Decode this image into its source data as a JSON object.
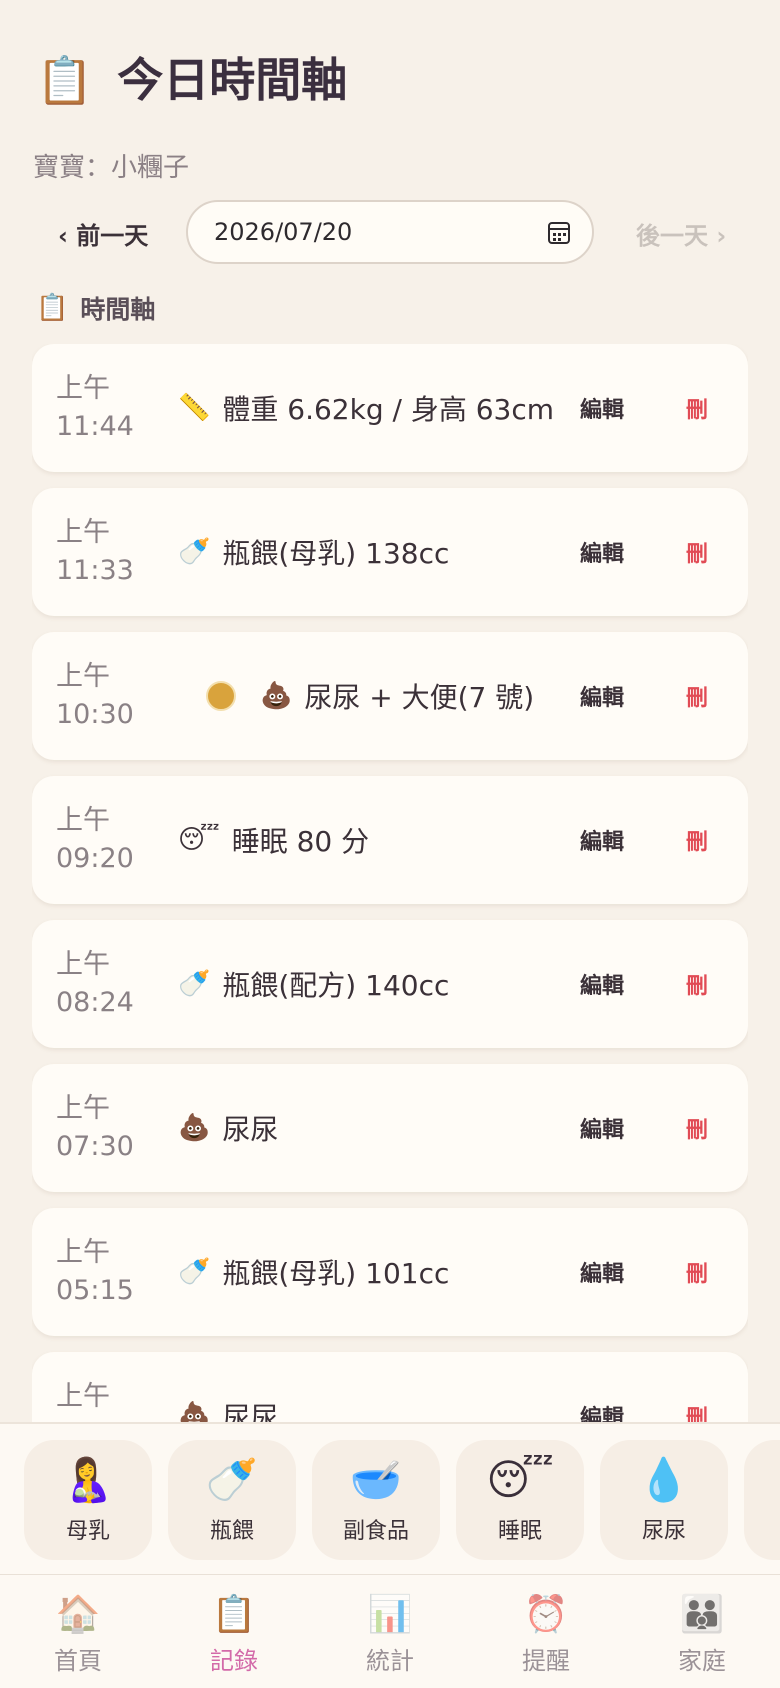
{
  "header": {
    "icon": "clipboard-icon",
    "icon_glyph": "📋",
    "title": "今日時間軸"
  },
  "baby_label": "寶寶：小糰子",
  "date_nav": {
    "prev_label": "‹ 前一天",
    "date_value": "2026/07/20",
    "next_label": "後一天 ›"
  },
  "section": {
    "icon_glyph": "📋",
    "title": "時間軸"
  },
  "entries": [
    {
      "period": "上午",
      "time": "11:44",
      "icon": "ruler-icon",
      "glyph": "📏",
      "text": "體重 6.62kg / 身高 63cm",
      "edit": "編輯",
      "delete": "刪"
    },
    {
      "period": "上午",
      "time": "11:33",
      "icon": "baby-bottle-icon",
      "glyph": "🍼",
      "text": "瓶餵(母乳) 138cc",
      "edit": "編輯",
      "delete": "刪"
    },
    {
      "period": "上午",
      "time": "10:30",
      "icon": "poop-icon",
      "glyph": "💩",
      "text": "尿尿 + 大便(7 號)",
      "stool_color": "#d9a33c",
      "edit": "編輯",
      "delete": "刪"
    },
    {
      "period": "上午",
      "time": "09:20",
      "icon": "sleeping-face-icon",
      "glyph": "😴",
      "text": "睡眠 80 分",
      "edit": "編輯",
      "delete": "刪"
    },
    {
      "period": "上午",
      "time": "08:24",
      "icon": "baby-bottle-icon",
      "glyph": "🍼",
      "text": "瓶餵(配方) 140cc",
      "edit": "編輯",
      "delete": "刪"
    },
    {
      "period": "上午",
      "time": "07:30",
      "icon": "poop-icon",
      "glyph": "💩",
      "text": "尿尿",
      "edit": "編輯",
      "delete": "刪"
    },
    {
      "period": "上午",
      "time": "05:15",
      "icon": "baby-bottle-icon",
      "glyph": "🍼",
      "text": "瓶餵(母乳) 101cc",
      "edit": "編輯",
      "delete": "刪"
    },
    {
      "period": "上午",
      "time": "",
      "icon": "poop-icon",
      "glyph": "💩",
      "text": "尿尿",
      "edit": "編輯",
      "delete": "刪"
    }
  ],
  "quick_actions": [
    {
      "icon": "breastfeeding-icon",
      "glyph": "🤱",
      "label": "母乳"
    },
    {
      "icon": "baby-bottle-icon",
      "glyph": "🍼",
      "label": "瓶餵"
    },
    {
      "icon": "bowl-icon",
      "glyph": "🥣",
      "label": "副食品"
    },
    {
      "icon": "sleeping-face-icon",
      "glyph": "😴",
      "label": "睡眠"
    },
    {
      "icon": "droplet-icon",
      "glyph": "💧",
      "label": "尿尿"
    }
  ],
  "bottom_nav": [
    {
      "icon": "home-icon",
      "glyph": "🏠",
      "label": "首頁",
      "active": false
    },
    {
      "icon": "clipboard-icon",
      "glyph": "📋",
      "label": "記錄",
      "active": true
    },
    {
      "icon": "chart-icon",
      "glyph": "📊",
      "label": "統計",
      "active": false
    },
    {
      "icon": "alarm-clock-icon",
      "glyph": "⏰",
      "label": "提醒",
      "active": false
    },
    {
      "icon": "family-icon",
      "glyph": "👪",
      "label": "家庭",
      "active": false
    }
  ],
  "colors": {
    "background": "#f7f1e9",
    "accent": "#d36aa9",
    "delete": "#e14b55"
  }
}
